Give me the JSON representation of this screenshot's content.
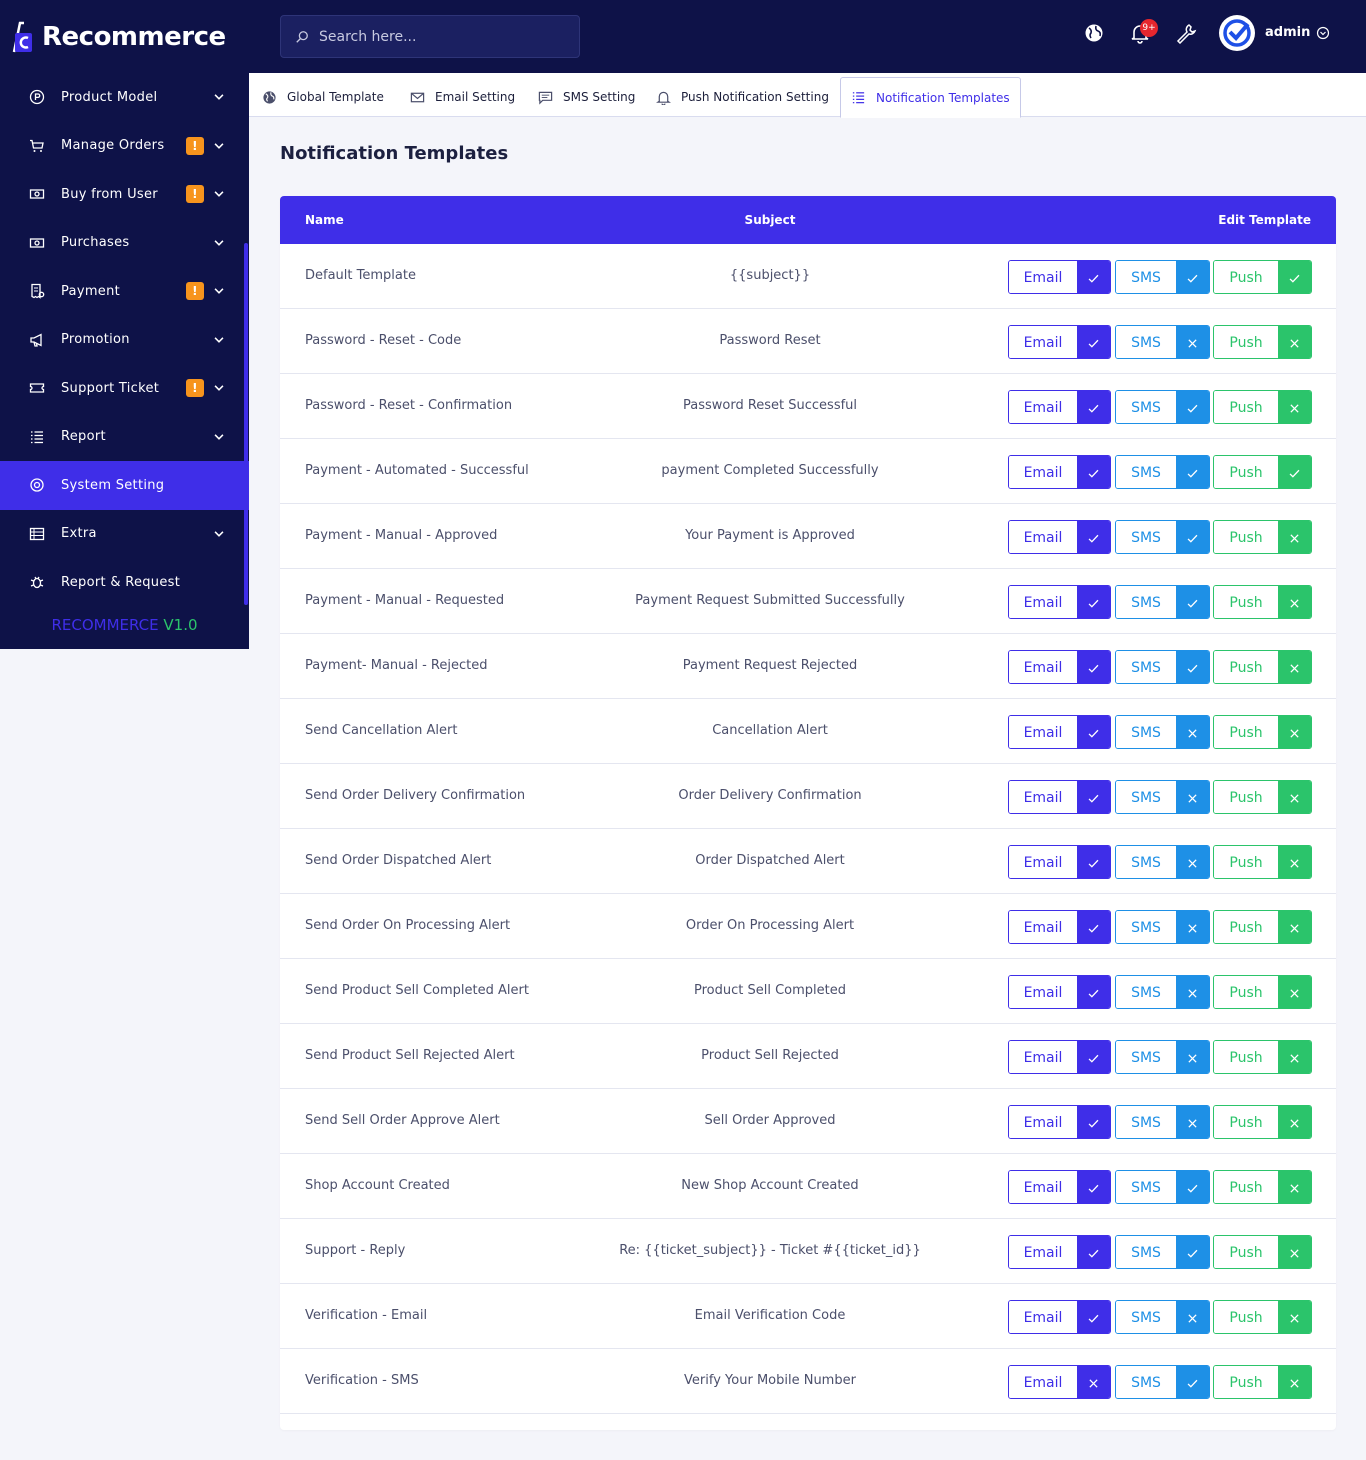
{
  "brand": {
    "name": "Recommerce"
  },
  "version": {
    "name": "RECOMMERCE",
    "number": "V1.0"
  },
  "search": {
    "placeholder": "Search here..."
  },
  "notifications": {
    "badge": "9+"
  },
  "user": {
    "name": "admin"
  },
  "sidebar": {
    "items": [
      {
        "label": "Product Model",
        "icon": "product-icon",
        "badge": "",
        "chevron": true,
        "active": false
      },
      {
        "label": "Manage Orders",
        "icon": "cart-icon",
        "badge": "!",
        "chevron": true,
        "active": false
      },
      {
        "label": "Buy from User",
        "icon": "cash-icon",
        "badge": "!",
        "chevron": true,
        "active": false
      },
      {
        "label": "Purchases",
        "icon": "cash-icon",
        "badge": "",
        "chevron": true,
        "active": false
      },
      {
        "label": "Payment",
        "icon": "receipt-icon",
        "badge": "!",
        "chevron": true,
        "active": false
      },
      {
        "label": "Promotion",
        "icon": "megaphone-icon",
        "badge": "",
        "chevron": true,
        "active": false
      },
      {
        "label": "Support Ticket",
        "icon": "ticket-icon",
        "badge": "!",
        "chevron": true,
        "active": false
      },
      {
        "label": "Report",
        "icon": "list-icon",
        "badge": "",
        "chevron": true,
        "active": false
      },
      {
        "label": "System Setting",
        "icon": "gear-icon",
        "badge": "",
        "chevron": false,
        "active": true
      },
      {
        "label": "Extra",
        "icon": "table-icon",
        "badge": "",
        "chevron": true,
        "active": false
      },
      {
        "label": "Report & Request",
        "icon": "bug-icon",
        "badge": "",
        "chevron": false,
        "active": false
      }
    ]
  },
  "tabs": [
    {
      "label": "Global Template",
      "icon": "globe-icon",
      "active": false
    },
    {
      "label": "Email Setting",
      "icon": "mail-icon",
      "active": false
    },
    {
      "label": "SMS Setting",
      "icon": "message-icon",
      "active": false
    },
    {
      "label": "Push Notification Setting",
      "icon": "bell-icon",
      "active": false
    },
    {
      "label": "Notification Templates",
      "icon": "list-icon",
      "active": true
    }
  ],
  "page": {
    "title": "Notification Templates"
  },
  "table": {
    "headers": {
      "name": "Name",
      "subject": "Subject",
      "edit": "Edit Template"
    },
    "channel_labels": {
      "email": "Email",
      "sms": "SMS",
      "push": "Push"
    },
    "colors": {
      "email": "#3f2ee8",
      "sms": "#1e90e6",
      "push": "#2bc46b"
    },
    "rows": [
      {
        "name": "Default Template",
        "subject": "{{subject}}",
        "email": true,
        "sms": true,
        "push": true
      },
      {
        "name": "Password - Reset - Code",
        "subject": "Password Reset",
        "email": true,
        "sms": false,
        "push": false
      },
      {
        "name": "Password - Reset - Confirmation",
        "subject": "Password Reset Successful",
        "email": true,
        "sms": true,
        "push": false
      },
      {
        "name": "Payment - Automated - Successful",
        "subject": "payment Completed Successfully",
        "email": true,
        "sms": true,
        "push": true
      },
      {
        "name": "Payment - Manual - Approved",
        "subject": "Your Payment is Approved",
        "email": true,
        "sms": true,
        "push": false
      },
      {
        "name": "Payment - Manual - Requested",
        "subject": "Payment Request Submitted Successfully",
        "email": true,
        "sms": true,
        "push": false
      },
      {
        "name": "Payment- Manual - Rejected",
        "subject": "Payment Request Rejected",
        "email": true,
        "sms": true,
        "push": false
      },
      {
        "name": "Send Cancellation Alert",
        "subject": "Cancellation Alert",
        "email": true,
        "sms": false,
        "push": false
      },
      {
        "name": "Send Order Delivery Confirmation",
        "subject": "Order Delivery Confirmation",
        "email": true,
        "sms": false,
        "push": false
      },
      {
        "name": "Send Order Dispatched Alert",
        "subject": "Order Dispatched Alert",
        "email": true,
        "sms": false,
        "push": false
      },
      {
        "name": "Send Order On Processing Alert",
        "subject": "Order On Processing Alert",
        "email": true,
        "sms": false,
        "push": false
      },
      {
        "name": "Send Product Sell Completed Alert",
        "subject": "Product Sell Completed",
        "email": true,
        "sms": false,
        "push": false
      },
      {
        "name": "Send Product Sell Rejected Alert",
        "subject": "Product Sell Rejected",
        "email": true,
        "sms": false,
        "push": false
      },
      {
        "name": "Send Sell Order Approve Alert",
        "subject": "Sell Order Approved",
        "email": true,
        "sms": false,
        "push": false
      },
      {
        "name": "Shop Account Created",
        "subject": "New Shop Account Created",
        "email": true,
        "sms": true,
        "push": false
      },
      {
        "name": "Support - Reply",
        "subject": "Re: {{ticket_subject}} - Ticket #{{ticket_id}}",
        "email": true,
        "sms": true,
        "push": false
      },
      {
        "name": "Verification - Email",
        "subject": "Email Verification Code",
        "email": true,
        "sms": false,
        "push": false
      },
      {
        "name": "Verification - SMS",
        "subject": "Verify Your Mobile Number",
        "email": false,
        "sms": true,
        "push": false
      }
    ]
  }
}
